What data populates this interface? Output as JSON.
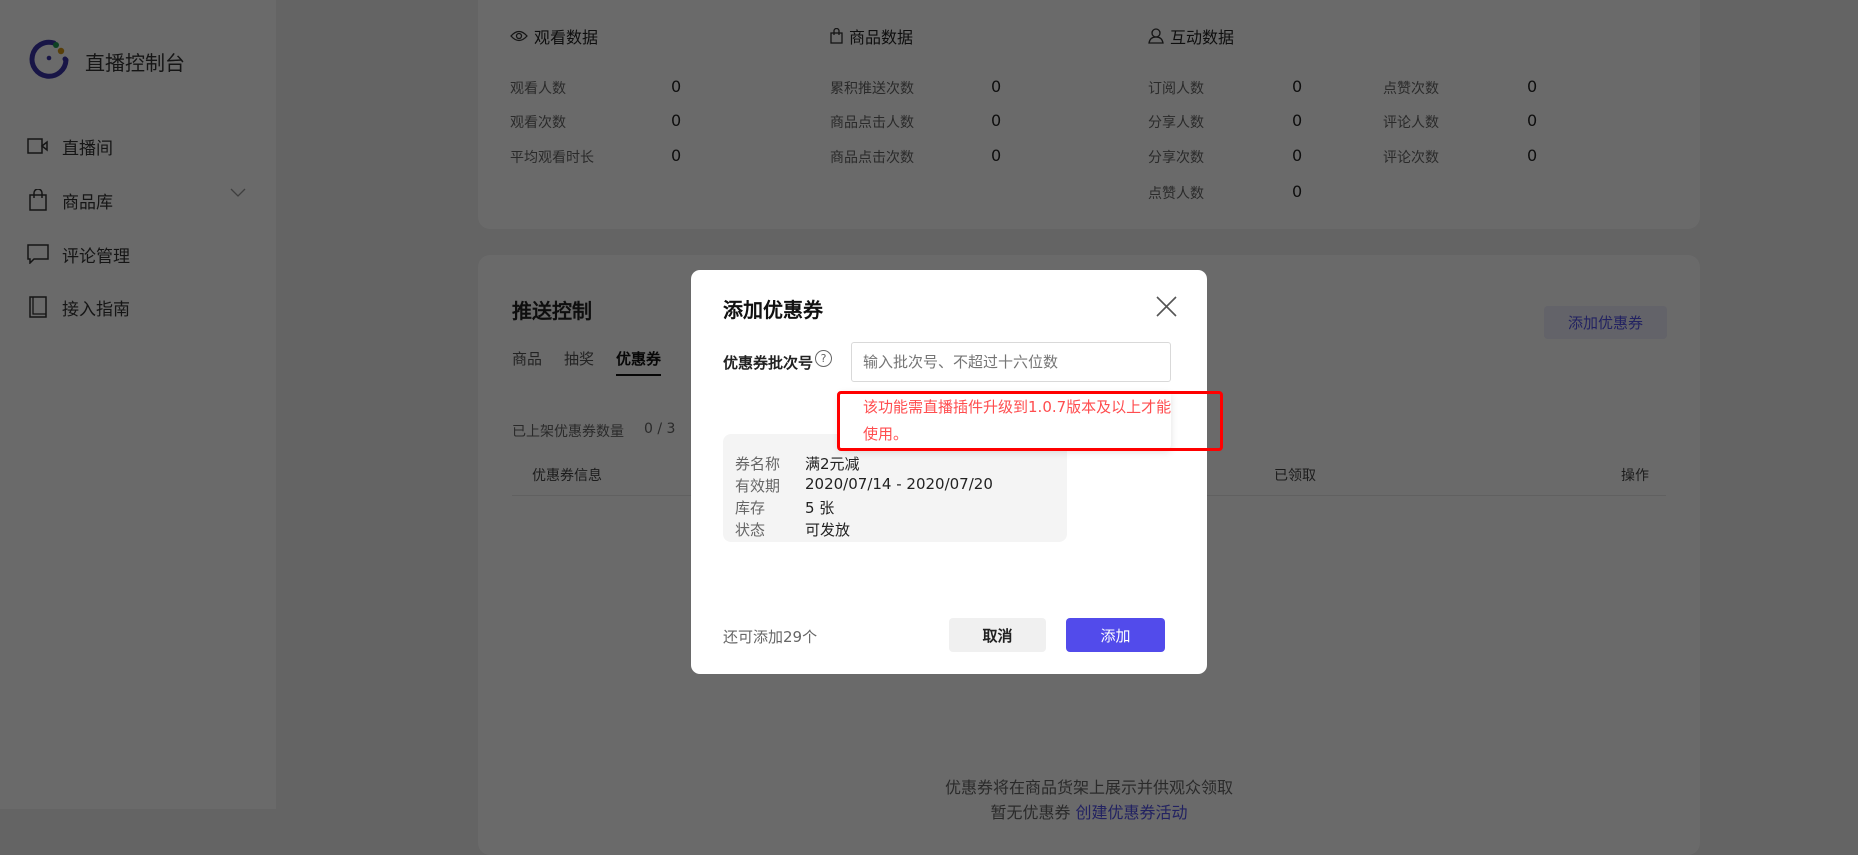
{
  "sidebar": {
    "app_title": "直播控制台",
    "brand_color": "#3b33a8",
    "items": [
      {
        "label": "直播间",
        "icon": "video-camera-icon"
      },
      {
        "label": "商品库",
        "icon": "shopping-bag-icon",
        "expandable": true
      },
      {
        "label": "评论管理",
        "icon": "comment-icon"
      },
      {
        "label": "接入指南",
        "icon": "book-icon"
      }
    ]
  },
  "stats": {
    "watch": {
      "title": "观看数据",
      "icon": "eye-icon",
      "rows": [
        {
          "label": "观看人数",
          "value": "0"
        },
        {
          "label": "观看次数",
          "value": "0"
        },
        {
          "label": "平均观看时长",
          "value": "0"
        }
      ]
    },
    "goods": {
      "title": "商品数据",
      "icon": "shopping-bag-icon",
      "rows": [
        {
          "label": "累积推送次数",
          "value": "0"
        },
        {
          "label": "商品点击人数",
          "value": "0"
        },
        {
          "label": "商品点击次数",
          "value": "0"
        }
      ]
    },
    "interact": {
      "title": "互动数据",
      "icon": "user-icon",
      "rows": [
        {
          "label": "订阅人数",
          "value": "0"
        },
        {
          "label": "分享人数",
          "value": "0"
        },
        {
          "label": "分享次数",
          "value": "0"
        },
        {
          "label": "点赞人数",
          "value": "0"
        }
      ],
      "rows2": [
        {
          "label": "点赞次数",
          "value": "0"
        },
        {
          "label": "评论人数",
          "value": "0"
        },
        {
          "label": "评论次数",
          "value": "0"
        }
      ]
    }
  },
  "push": {
    "title": "推送控制",
    "tabs": [
      "商品",
      "抽奖",
      "优惠券"
    ],
    "active_tab": "优惠券",
    "add_button": "添加优惠券",
    "count_label": "已上架优惠券数量",
    "count_value": "0 / 3",
    "columns": [
      "优惠券信息",
      "已领取",
      "操作"
    ],
    "empty_text": "优惠券将在商品货架上展示并供观众领取",
    "empty_text2": "暂无优惠券",
    "create_link": "创建优惠券活动"
  },
  "modal": {
    "title": "添加优惠券",
    "field_label": "优惠券批次号",
    "input_value": "",
    "input_placeholder": "输入批次号、不超过十六位数",
    "tooltip_line1": "该功能需直播插件升级到1.0.7版本及以上才能",
    "tooltip_line2": "使用。",
    "coupon": [
      {
        "label": "券名称",
        "value": "满2元减"
      },
      {
        "label": "有效期",
        "value": "2020/07/14 - 2020/07/20"
      },
      {
        "label": "库存",
        "value": "5 张"
      },
      {
        "label": "状态",
        "value": "可发放"
      }
    ],
    "remaining": "还可添加29个",
    "cancel": "取消",
    "confirm": "添加",
    "accent": "#524beb",
    "error_color": "#ff4d4f",
    "highlight_color": "#ff0000"
  }
}
